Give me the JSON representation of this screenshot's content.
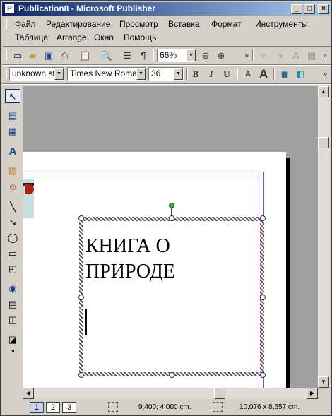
{
  "window": {
    "title": "Publication8 - Microsoft Publisher",
    "app_icon": "publisher-icon",
    "controls": {
      "minimize": "_",
      "maximize": "□",
      "close": "×"
    }
  },
  "menu": {
    "row1": [
      "Файл",
      "Редактирование",
      "Просмотр",
      "Вставка",
      "Формат",
      "Инструменты"
    ],
    "row2": [
      "Таблица",
      "Arrange",
      "Окно",
      "Помощь"
    ]
  },
  "standard_toolbar": {
    "zoom_value": "66%",
    "icons": [
      "new-icon",
      "open-icon",
      "save-icon",
      "print-preview-icon",
      "paste-icon",
      "search-icon",
      "columns-icon",
      "pilcrow-icon",
      "zoom-out-icon",
      "zoom-in-icon",
      "more-icon",
      "link-icon",
      "unlink-icon",
      "format-painter-icon",
      "picture-icon"
    ]
  },
  "formatting_toolbar": {
    "style_value": "unknown sty",
    "font_value": "Times New Roman",
    "size_value": "36",
    "bold": "B",
    "italic": "I",
    "underline": "U",
    "shrink_font": "A",
    "grow_font": "A"
  },
  "document": {
    "text_line1": "КНИГА О",
    "text_line2": "ПРИРОДЕ"
  },
  "status": {
    "pages": [
      "1",
      "2",
      "3"
    ],
    "active_page": "1",
    "position": "9,400; 4,000 cm.",
    "size": "10,076 x   8,657 cm."
  }
}
